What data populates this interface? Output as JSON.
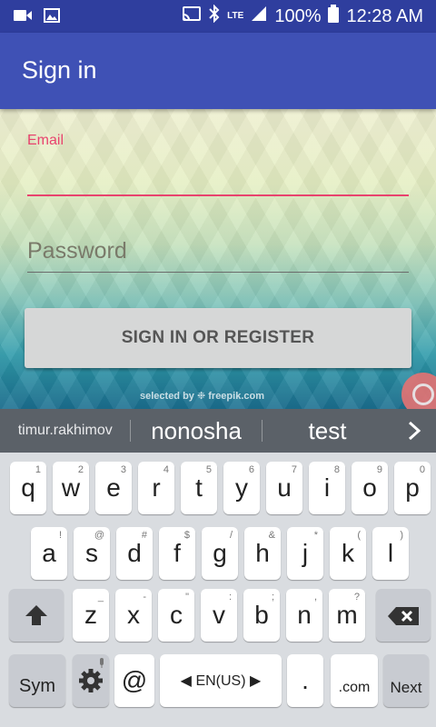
{
  "status_bar": {
    "left_icons": [
      "video-camera-icon",
      "image-icon"
    ],
    "right_icons": [
      "cast-icon",
      "bluetooth-icon",
      "signal-icon",
      "battery-icon"
    ],
    "network": "LTE",
    "battery": "100%",
    "time": "12:28 AM"
  },
  "app_bar": {
    "title": "Sign in"
  },
  "form": {
    "email_label": "Email",
    "email_value": "",
    "password_placeholder": "Password",
    "submit_label": "SIGN IN OR REGISTER",
    "credit": "selected by ❉ freepik.com"
  },
  "suggestions": {
    "items": [
      "timur.rakhimov",
      "nonosha",
      "test"
    ],
    "more_icon": "chevron-right-icon"
  },
  "keyboard": {
    "row1": [
      {
        "k": "q",
        "s": "1"
      },
      {
        "k": "w",
        "s": "2"
      },
      {
        "k": "e",
        "s": "3"
      },
      {
        "k": "r",
        "s": "4"
      },
      {
        "k": "t",
        "s": "5"
      },
      {
        "k": "y",
        "s": "6"
      },
      {
        "k": "u",
        "s": "7"
      },
      {
        "k": "i",
        "s": "8"
      },
      {
        "k": "o",
        "s": "9"
      },
      {
        "k": "p",
        "s": "0"
      }
    ],
    "row2": [
      {
        "k": "a",
        "s": "!"
      },
      {
        "k": "s",
        "s": "@"
      },
      {
        "k": "d",
        "s": "#"
      },
      {
        "k": "f",
        "s": "$"
      },
      {
        "k": "g",
        "s": "/"
      },
      {
        "k": "h",
        "s": "&"
      },
      {
        "k": "j",
        "s": "*"
      },
      {
        "k": "k",
        "s": "("
      },
      {
        "k": "l",
        "s": ")"
      }
    ],
    "row3": [
      {
        "k": "z",
        "s": "_"
      },
      {
        "k": "x",
        "s": "-"
      },
      {
        "k": "c",
        "s": "\""
      },
      {
        "k": "v",
        "s": ":"
      },
      {
        "k": "b",
        "s": ";"
      },
      {
        "k": "n",
        "s": ","
      },
      {
        "k": "m",
        "s": "?"
      }
    ],
    "sym_label": "Sym",
    "at_label": "@",
    "language_label": "EN(US)",
    "period_label": ".",
    "dotcom_label": ".com",
    "next_label": "Next"
  }
}
